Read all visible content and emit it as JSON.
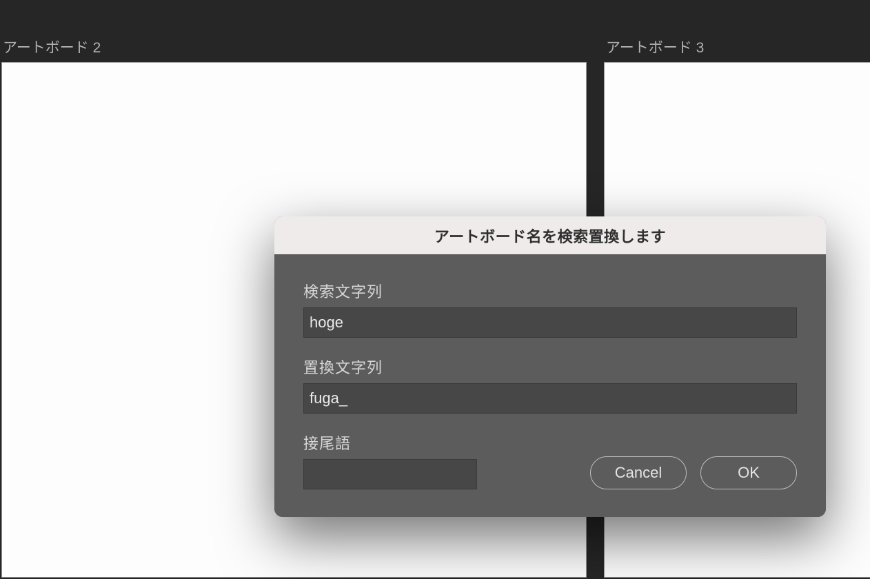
{
  "artboards": {
    "left": {
      "title": "アートボード 2"
    },
    "right": {
      "title": "アートボード 3"
    }
  },
  "dialog": {
    "title": "アートボード名を検索置換します",
    "search": {
      "label": "検索文字列",
      "value": "hoge"
    },
    "replace": {
      "label": "置換文字列",
      "value": "fuga_"
    },
    "suffix": {
      "label": "接尾語",
      "value": ""
    },
    "buttons": {
      "cancel": "Cancel",
      "ok": "OK"
    }
  }
}
